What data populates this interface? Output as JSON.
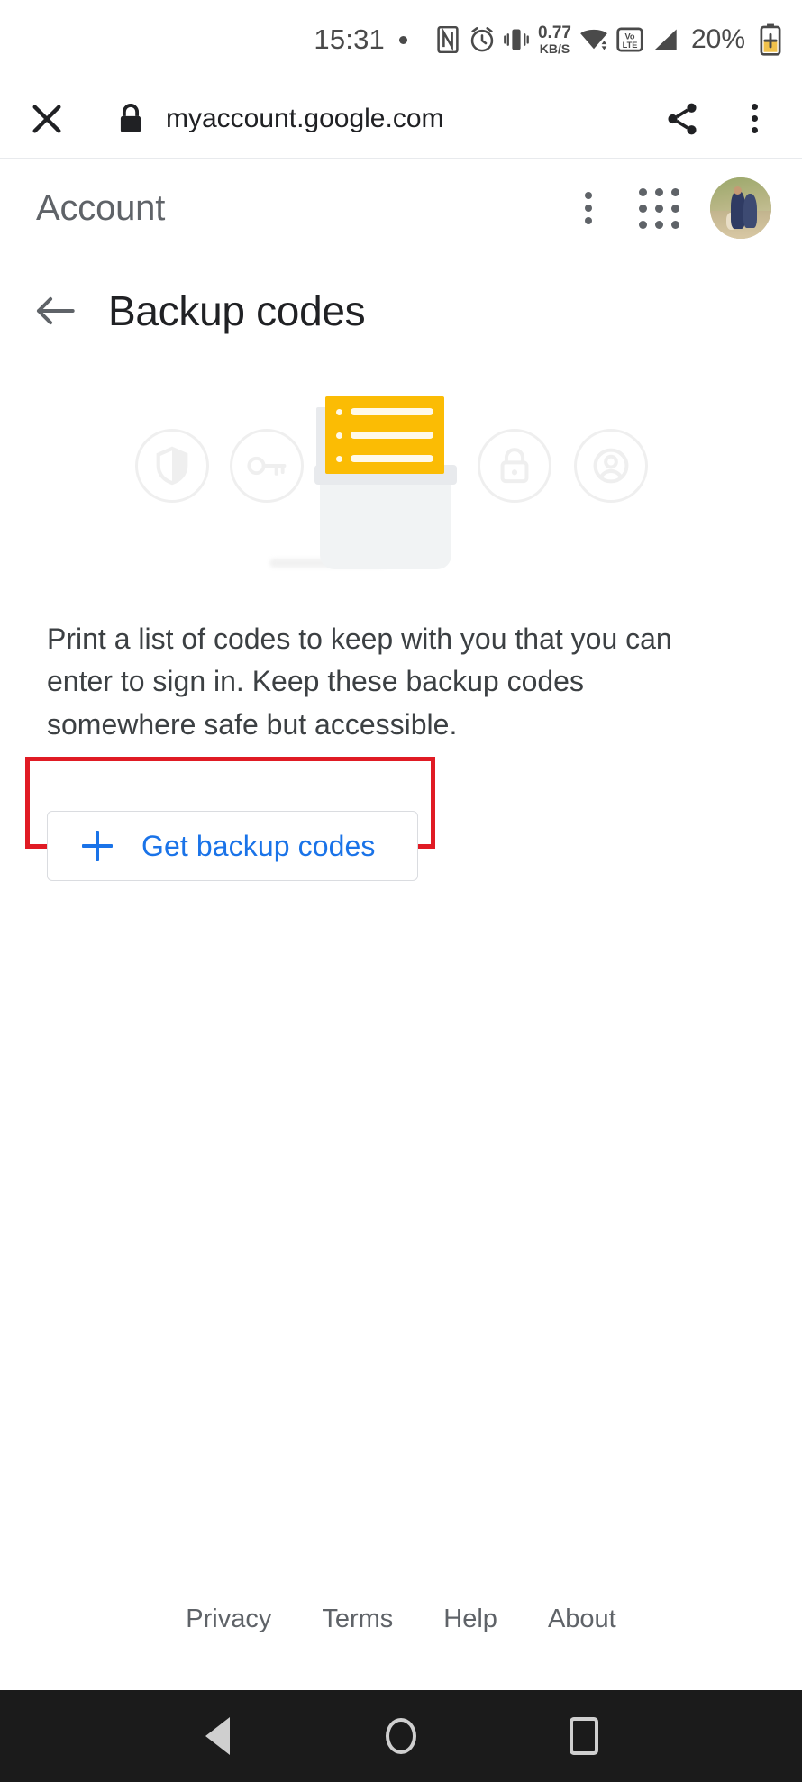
{
  "statusbar": {
    "time": "15:31",
    "icons": [
      "notification-dot",
      "nfc-icon",
      "alarm-icon",
      "vibrate-icon"
    ],
    "network_speed_value": "0.77",
    "network_speed_unit": "KB/S",
    "wifi": "wifi-icon",
    "volte_label_top": "Vo",
    "volte_label_bottom": "LTE",
    "signal": "signal-icon",
    "battery_percent": "20%",
    "battery_icon": "battery-saver-icon"
  },
  "tabbar": {
    "close_label": "✕",
    "lock_icon": "lock-icon",
    "url": "myaccount.google.com",
    "share_icon": "share-icon",
    "overflow_icon": "more-vert-icon"
  },
  "account_header": {
    "title": "Account",
    "overflow_icon": "more-vert-icon",
    "apps_icon": "apps-grid-icon",
    "avatar": "user-avatar"
  },
  "page": {
    "back_icon": "arrow-back-icon",
    "title": "Backup codes",
    "description": "Print a list of codes to keep with you that you can enter to sign in. Keep these backup codes somewhere safe but accessible."
  },
  "illustration": {
    "ghost_icons": [
      "shield-icon",
      "key-icon",
      "lock-icon",
      "person-icon"
    ],
    "card_color": "#fbbc04",
    "printer_color": "#f1f3f4"
  },
  "action": {
    "button_label": "Get backup codes",
    "plus_icon": "plus-icon",
    "accent_color": "#1a73e8",
    "highlight_color": "#e01b24"
  },
  "footer": {
    "links": [
      {
        "label": "Privacy"
      },
      {
        "label": "Terms"
      },
      {
        "label": "Help"
      },
      {
        "label": "About"
      }
    ]
  },
  "navbar": {
    "back": "nav-back-icon",
    "home": "nav-home-icon",
    "recents": "nav-recents-icon"
  }
}
